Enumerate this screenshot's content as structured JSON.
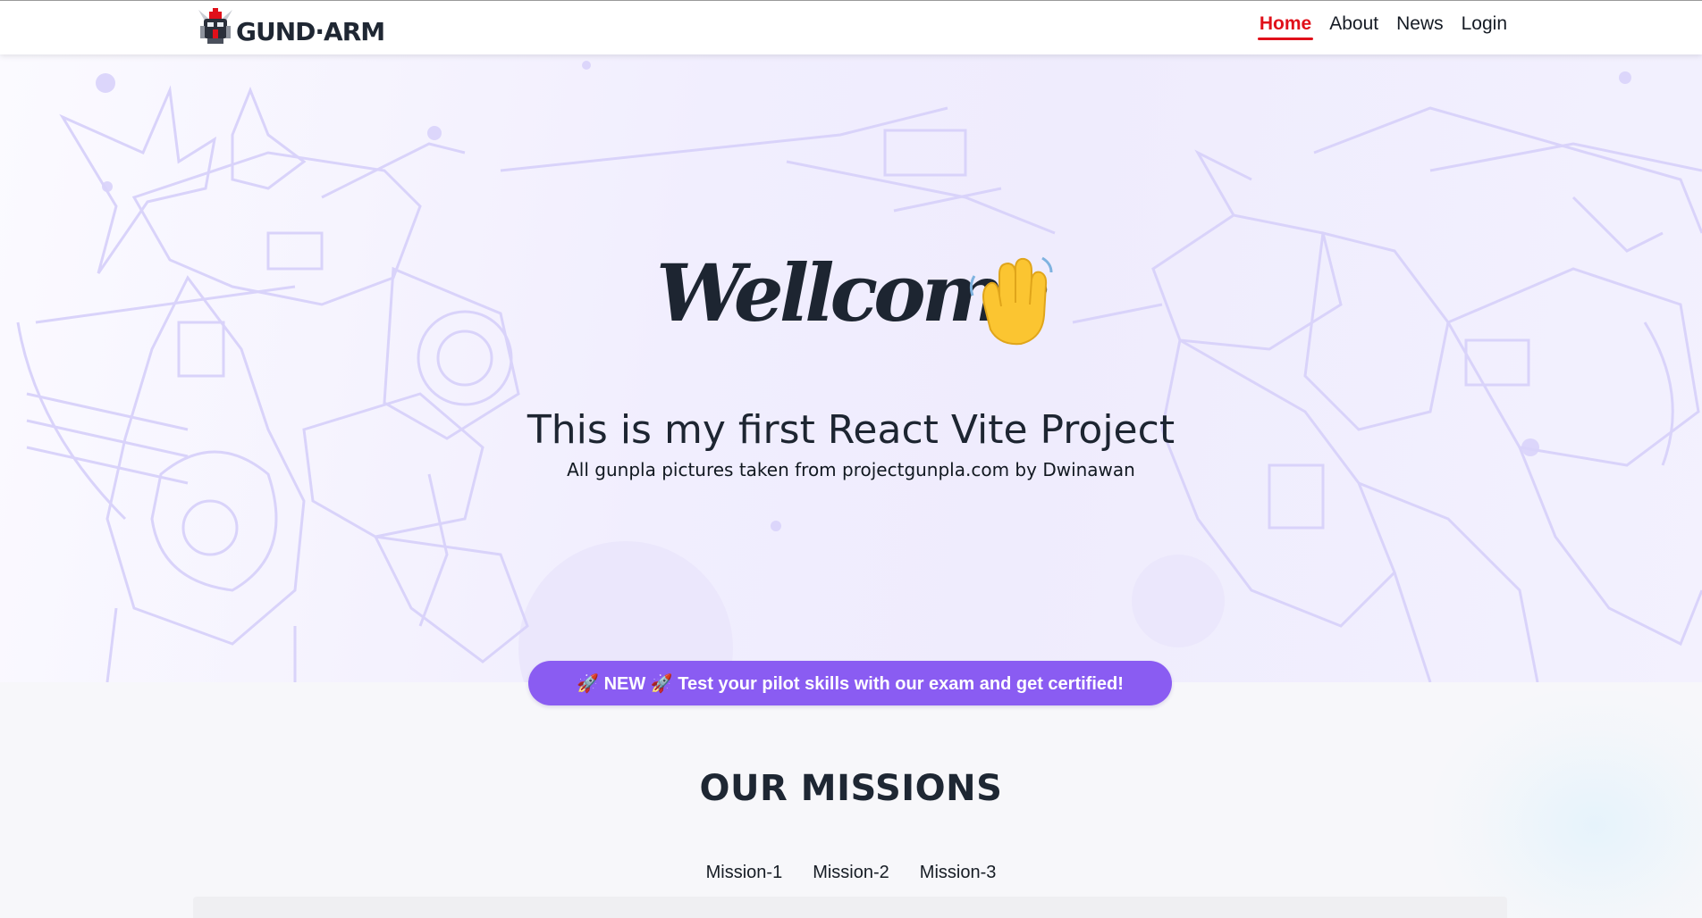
{
  "header": {
    "logo_text": "GUND·ARM",
    "nav": [
      {
        "label": "Home",
        "active": true
      },
      {
        "label": "About",
        "active": false
      },
      {
        "label": "News",
        "active": false
      },
      {
        "label": "Login",
        "active": false
      }
    ]
  },
  "hero": {
    "heading": "Wellcome",
    "heading_icon": "waving-hand-icon",
    "subtitle": "This is my first React Vite Project",
    "credit": "All gunpla pictures taken from projectgunpla.com by Dwinawan"
  },
  "cta": {
    "label": "🚀 NEW 🚀 Test your pilot skills with our exam and get certified!"
  },
  "missions": {
    "title": "OUR MISSIONS",
    "tabs": [
      "Mission-1",
      "Mission-2",
      "Mission-3"
    ]
  },
  "colors": {
    "accent": "#e0101a",
    "cta": "#8a5cf2",
    "text_dark": "#1d2531",
    "hero_line_art": "#d9d3fa"
  }
}
